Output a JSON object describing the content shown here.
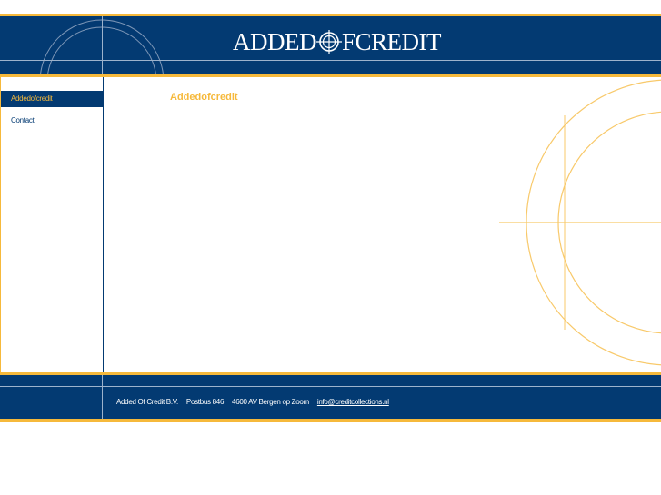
{
  "header": {
    "logo_text_left": "ADDED",
    "logo_text_right": "FCREDIT"
  },
  "sidebar": {
    "items": [
      {
        "label": "Addedofcredit",
        "active": true
      },
      {
        "label": "Contact",
        "active": false
      }
    ]
  },
  "main": {
    "title": "Addedofcredit"
  },
  "footer": {
    "company": "Added Of Credit B.V.",
    "postbus": "Postbus 846",
    "address": "4600 AV Bergen op Zoom",
    "email": "info@creditcollections.nl"
  },
  "colors": {
    "navy": "#033a72",
    "gold": "#f6b93b",
    "line": "#9db3cc"
  },
  "icons": {
    "logo_mark": "crosshair-o-icon"
  }
}
